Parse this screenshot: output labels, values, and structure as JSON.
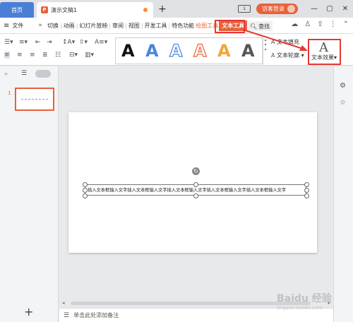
{
  "titlebar": {
    "home_tab": "首页",
    "doc_tab": "演示文稿1",
    "new_tab": "+",
    "window_badge": "1",
    "login": "访客登录"
  },
  "menubar": {
    "file": "文件",
    "tabs": [
      {
        "label": "切换",
        "state": "normal"
      },
      {
        "label": "|",
        "state": "sep"
      },
      {
        "label": "动画",
        "state": "normal"
      },
      {
        "label": "|",
        "state": "sep"
      },
      {
        "label": "幻灯片放映",
        "state": "normal"
      },
      {
        "label": "|",
        "state": "sep"
      },
      {
        "label": "审阅",
        "state": "normal"
      },
      {
        "label": "|",
        "state": "sep"
      },
      {
        "label": "视图",
        "state": "normal"
      },
      {
        "label": "|",
        "state": "sep"
      },
      {
        "label": "开发工具",
        "state": "normal"
      },
      {
        "label": "|",
        "state": "sep"
      },
      {
        "label": "特色功能",
        "state": "normal"
      },
      {
        "label": "绘图工具",
        "state": "orange"
      },
      {
        "label": "文本工具",
        "state": "active"
      }
    ],
    "search": "查找"
  },
  "ribbon": {
    "text_fill": "文本填充",
    "text_outline": "文本轮廓",
    "text_effect": "文本效果",
    "style_letter": "A",
    "styles": [
      {
        "color": "#111111",
        "type": "solid"
      },
      {
        "color": "#4a86d8",
        "type": "solid"
      },
      {
        "color": "#4a86d8",
        "type": "outline"
      },
      {
        "color": "#e8613a",
        "type": "outline"
      },
      {
        "color": "#f2a53a",
        "type": "solid"
      },
      {
        "color": "#555555",
        "type": "solid"
      }
    ]
  },
  "slides": {
    "number": "1",
    "add": "+"
  },
  "slide": {
    "textbox_text": "插入文本框输入文字插入文本框输入文字插入文本框输入文字插入文本框输入文字插入文本框输入文字"
  },
  "notes": {
    "placeholder": "单击此处添加备注"
  },
  "watermark": {
    "main": "Baidu 经验",
    "sub": "jingyan.baidu.com"
  }
}
